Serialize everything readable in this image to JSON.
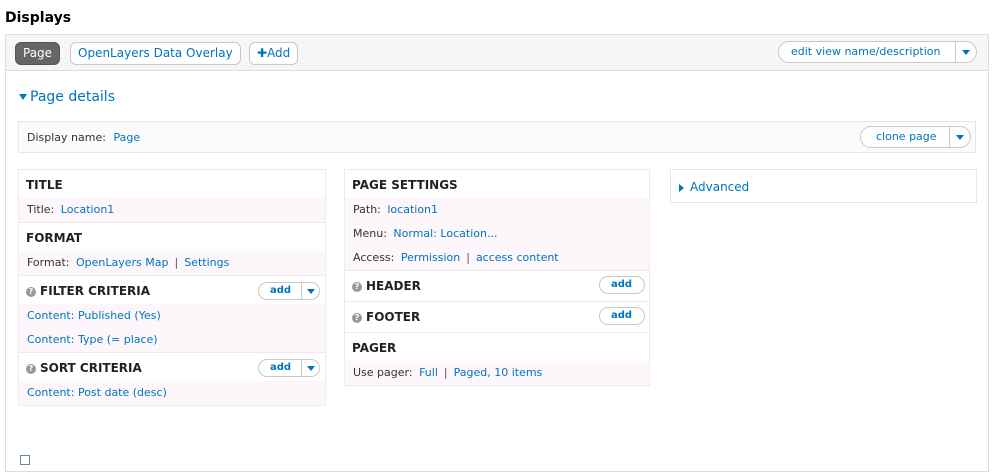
{
  "heading": "Displays",
  "tabs": {
    "page": "Page",
    "openlayers": "OpenLayers Data Overlay",
    "add": "Add"
  },
  "edit_view": "edit view name/description",
  "page_details": "Page details",
  "display_name": {
    "label": "Display name:",
    "value": "Page"
  },
  "clone_page": "clone page",
  "title_section": {
    "heading": "TITLE",
    "label": "Title:",
    "value": "Location1"
  },
  "format_section": {
    "heading": "FORMAT",
    "label": "Format:",
    "value": "OpenLayers Map",
    "settings": "Settings"
  },
  "filter_section": {
    "heading": "FILTER CRITERIA",
    "add": "add",
    "items": [
      "Content: Published (Yes)",
      "Content: Type (= place)"
    ]
  },
  "sort_section": {
    "heading": "SORT CRITERIA",
    "add": "add",
    "items": [
      "Content: Post date (desc)"
    ]
  },
  "page_settings": {
    "heading": "PAGE SETTINGS",
    "path_label": "Path:",
    "path_value": "location1",
    "menu_label": "Menu:",
    "menu_value": "Normal: Location...",
    "access_label": "Access:",
    "access_value1": "Permission",
    "access_value2": "access content"
  },
  "header_section": {
    "heading": "HEADER",
    "add": "add"
  },
  "footer_section": {
    "heading": "FOOTER",
    "add": "add"
  },
  "pager_section": {
    "heading": "PAGER",
    "label": "Use pager:",
    "value1": "Full",
    "value2": "Paged, 10 items"
  },
  "advanced": "Advanced",
  "colors": {
    "link": "#0074bd",
    "active_tab": "#666666",
    "row_bg": "#fdf6fb"
  }
}
